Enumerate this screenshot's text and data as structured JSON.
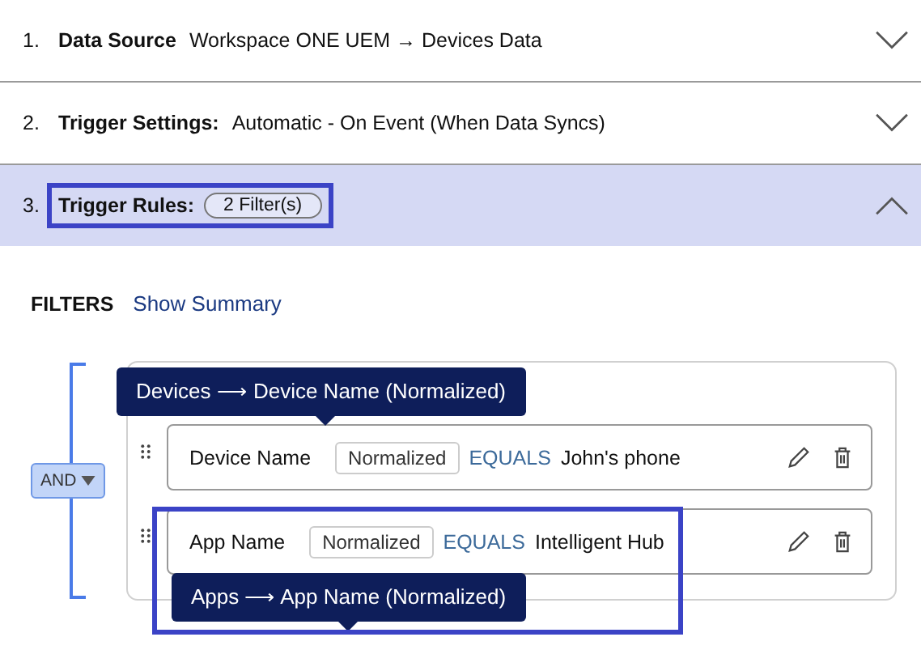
{
  "steps": [
    {
      "number": "1.",
      "title": "Data Source",
      "value": "Workspace ONE UEM → Devices Data",
      "expanded": false,
      "highlighted": false
    },
    {
      "number": "2.",
      "title": "Trigger Settings:",
      "value": "Automatic - On Event (When Data Syncs)",
      "expanded": false,
      "highlighted": false
    },
    {
      "number": "3.",
      "title": "Trigger Rules:",
      "badge": "2 Filter(s)",
      "expanded": true,
      "highlighted": true
    }
  ],
  "filters": {
    "heading": "FILTERS",
    "summary_link": "Show Summary",
    "operator": "AND",
    "rules": [
      {
        "field": "Device Name",
        "tag": "Normalized",
        "operator": "EQUALS",
        "value": "John's phone",
        "tooltip": "Devices ⟶ Device Name (Normalized)",
        "highlighted": false
      },
      {
        "field": "App Name",
        "tag": "Normalized",
        "operator": "EQUALS",
        "value": "Intelligent Hub",
        "tooltip": "Apps ⟶ App Name (Normalized)",
        "highlighted": true
      }
    ]
  }
}
